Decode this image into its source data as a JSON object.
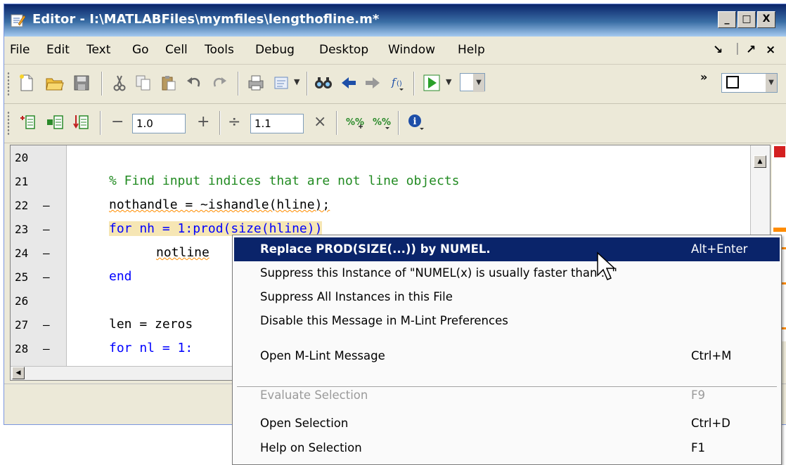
{
  "window": {
    "title": "Editor - I:\\MATLABFiles\\mymfiles\\lengthofline.m*",
    "controls": [
      "_",
      "□",
      "X"
    ]
  },
  "menubar": {
    "items": [
      {
        "label": "File",
        "mnemonic": "F"
      },
      {
        "label": "Edit",
        "mnemonic": "E"
      },
      {
        "label": "Text",
        "mnemonic": "T"
      },
      {
        "label": "Go",
        "mnemonic": "G"
      },
      {
        "label": "Cell",
        "mnemonic": "C"
      },
      {
        "label": "Tools",
        "mnemonic": "o"
      },
      {
        "label": "Debug",
        "mnemonic": "b"
      },
      {
        "label": "Desktop",
        "mnemonic": "D"
      },
      {
        "label": "Window",
        "mnemonic": "W"
      },
      {
        "label": "Help",
        "mnemonic": "H"
      }
    ],
    "right_controls": [
      "↘",
      "↗",
      "×"
    ]
  },
  "toolbar1": {
    "icons": [
      "new-file-icon",
      "open-folder-icon",
      "save-icon",
      "cut-icon",
      "copy-icon",
      "paste-icon",
      "undo-icon",
      "redo-icon",
      "print-icon",
      "view-icon",
      "find-icon",
      "back-icon",
      "forward-icon",
      "function-icon",
      "run-icon"
    ],
    "overflow": "»"
  },
  "toolbar2": {
    "icons": [
      "insert-cell-icon",
      "cell-divider-icon",
      "evaluate-cell-icon",
      "decrement-icon",
      "increment-icon",
      "divide-icon",
      "multiply-icon",
      "cell-percent-add-icon",
      "cell-percent-remove-icon",
      "info-icon"
    ],
    "decrement": "−",
    "increment": "+",
    "divide": "÷",
    "multiply": "×",
    "field1_value": "1.0",
    "field2_value": "1.1"
  },
  "editor": {
    "lines": [
      {
        "num": "20",
        "dash": "",
        "code": ""
      },
      {
        "num": "21",
        "dash": "",
        "code": "% Find input indices that are not line objects"
      },
      {
        "num": "22",
        "dash": "—",
        "code": "nothandle = ~ishandle(hline);"
      },
      {
        "num": "23",
        "dash": "—",
        "code": "for nh = 1:prod(size(hline))"
      },
      {
        "num": "24",
        "dash": "—",
        "code": "notline"
      },
      {
        "num": "25",
        "dash": "—",
        "code": "end"
      },
      {
        "num": "26",
        "dash": "",
        "code": ""
      },
      {
        "num": "27",
        "dash": "—",
        "code": "len = zeros"
      },
      {
        "num": "28",
        "dash": "—",
        "code": "for nl = 1:"
      }
    ]
  },
  "context_menu": {
    "items": [
      {
        "label": "Replace PROD(SIZE(...)) by NUMEL.",
        "shortcut": "Alt+Enter",
        "state": "selected"
      },
      {
        "label": "Suppress this Instance of \"NUMEL(x) is usually faster than ...\"",
        "shortcut": "",
        "state": "normal"
      },
      {
        "label": "Suppress All Instances in this File",
        "shortcut": "",
        "state": "normal"
      },
      {
        "label": "Disable this Message in M-Lint Preferences",
        "shortcut": "",
        "state": "normal"
      },
      {
        "label": "Open M-Lint Message",
        "shortcut": "Ctrl+M",
        "state": "normal"
      },
      {
        "label": "Evaluate Selection",
        "shortcut": "F9",
        "state": "disabled"
      },
      {
        "label": "Open Selection",
        "shortcut": "Ctrl+D",
        "state": "normal"
      },
      {
        "label": "Help on Selection",
        "shortcut": "F1",
        "state": "normal"
      }
    ]
  },
  "colors": {
    "title_start": "#0a246a",
    "title_end": "#a6caf0",
    "menu_highlight": "#0a246a",
    "keyword": "#0000ff",
    "comment": "#228b22",
    "squiggle": "#ff8c00",
    "mlint_error": "#d42020",
    "mlint_warning": "#ff8c00"
  }
}
